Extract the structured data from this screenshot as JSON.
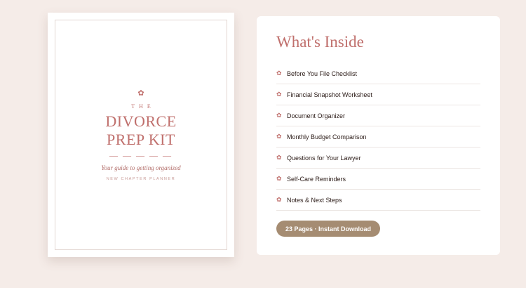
{
  "cover": {
    "flower_icon": "✿",
    "the": "THE",
    "title_line1": "DIVORCE",
    "title_line2": "PREP KIT",
    "rule": "— — — — —",
    "subtitle": "Your guide to getting organized",
    "series": "NEW CHAPTER PLANNER"
  },
  "panel": {
    "title": "What's Inside",
    "item_icon": "flower-icon",
    "items": [
      "Before You File Checklist",
      "Financial Snapshot Worksheet",
      "Document Organizer",
      "Monthly Budget Comparison",
      "Questions for Your Lawyer",
      "Self-Care Reminders",
      "Notes & Next Steps"
    ],
    "cta_label": "23 Pages · Instant Download"
  },
  "colors": {
    "background": "#f5ece8",
    "accent": "#c0706d",
    "button": "#a58c72",
    "text": "#2a1a16"
  }
}
